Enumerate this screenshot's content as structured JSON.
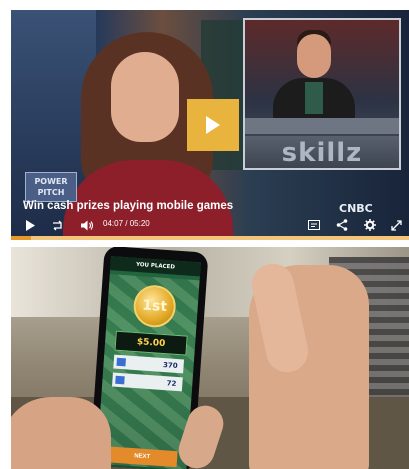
{
  "video": {
    "title": "Win cash prizes playing mobile games",
    "time_current": "04:07",
    "time_separator": "/",
    "time_total": "05:20",
    "progress": 0.05,
    "show_logo": "POWER PITCH",
    "network_logo": "CNBC",
    "inset_brand": "skillz",
    "controls": [
      "play-icon",
      "replay-icon",
      "volume-icon",
      "captions-icon",
      "share-icon",
      "settings-icon",
      "fullscreen-icon"
    ],
    "accent_color": "#e9b43d"
  },
  "phone_screen": {
    "header": "YOU PLACED",
    "place": "1st",
    "prize": "$5.00",
    "row1_value": "370",
    "row2_value": "72",
    "button": "NEXT"
  }
}
